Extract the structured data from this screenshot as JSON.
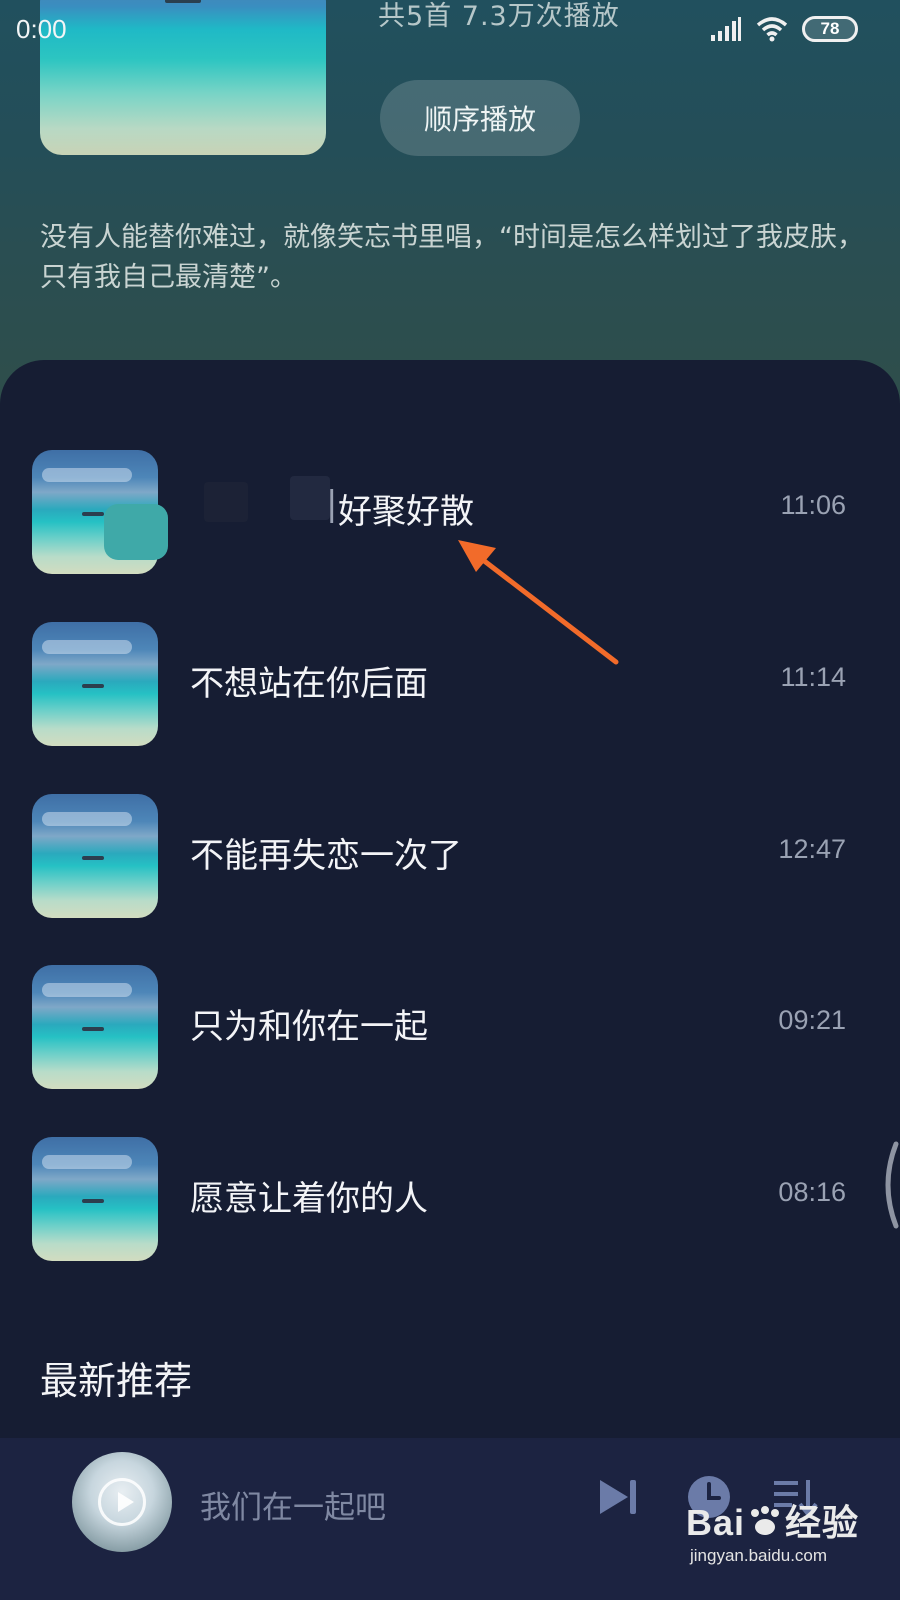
{
  "status_bar": {
    "time": "0:00",
    "battery": "78",
    "icons": [
      "signal-icon",
      "wifi-icon",
      "battery-icon"
    ]
  },
  "playlist": {
    "stats": "共5首   7.3万次播放",
    "play_order_label": "顺序播放",
    "description": "没有人能替你难过，就像笑忘书里唱，“时间是怎么样划过了我皮肤，只有我自己最清楚”。"
  },
  "songs": [
    {
      "title": "好聚好散",
      "title_prefix": "|",
      "duration": "11:06"
    },
    {
      "title": "不想站在你后面",
      "duration": "11:14"
    },
    {
      "title": "不能再失恋一次了",
      "duration": "12:47"
    },
    {
      "title": "只为和你在一起",
      "duration": "09:21"
    },
    {
      "title": "愿意让着你的人",
      "duration": "08:16"
    }
  ],
  "section": {
    "title": "最新推荐"
  },
  "mini_player": {
    "title": "我们在一起吧",
    "controls": [
      "next-icon",
      "timer-icon",
      "playlist-icon"
    ]
  },
  "watermark": {
    "brand_a": "Bai",
    "brand_b": "经验",
    "url": "jingyan.baidu.com"
  },
  "colors": {
    "background": "#161d33",
    "header_teal": "#244e58",
    "annotation_arrow": "#f26b2a",
    "mini_player_bg": "#1c2341"
  }
}
